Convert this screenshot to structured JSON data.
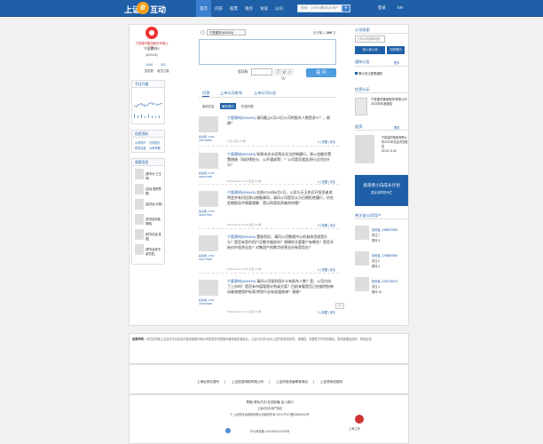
{
  "header": {
    "logo_left": "上证",
    "logo_e": "e",
    "logo_right": "互动",
    "nav": [
      "首页",
      "问答",
      "股票",
      "观点",
      "访谈",
      "公司"
    ],
    "search_placeholder": "搜索：公司/问题/观点/用户",
    "search_icon": "search-icon",
    "login": "登录",
    "lang": "EN"
  },
  "company": {
    "name_cn": "宁夏建材集团股份有限公司",
    "short": "宁夏建材V",
    "code": "(600449)",
    "followers": "1494",
    "followers_lbl": "被关注数",
    "answers": "101",
    "answers_lbl": "回答数"
  },
  "sidebar": {
    "today_title": "今日行情",
    "docs_title": "信息资料",
    "links": [
      "公司简介",
      "行情统计",
      "财务信息",
      "公司章程"
    ],
    "execs_title": "高管信息",
    "execs": [
      "[董事长 王玉林]",
      "[总经 理邢思刚]",
      "[副总经 武雄]",
      "[常务副总裁 董明]",
      "[财务总监 梁磊]",
      "[董事会秘书 谢茂发]"
    ]
  },
  "form": {
    "company_tag": "宁夏建材(600449)",
    "char_prefix": "还可输入",
    "char_count": "200",
    "char_suffix": "字",
    "captcha_label": "验证码",
    "captcha_text": "T g j W",
    "submit": "提 问"
  },
  "tabs": [
    "问答",
    "上市公司发布",
    "上市公司公告"
  ],
  "subtabs": [
    "最新答复",
    "最新提问",
    "热搜问题"
  ],
  "questions": [
    {
      "user": "投资者_1703 470794000",
      "co": "宁夏建材(600449)",
      "text": "请问截止4月20日公司的股东人数是多少？，谢谢？",
      "meta": "今日 来自 PC端",
      "like": "0",
      "fav": "收藏",
      "reply": "评论"
    },
    {
      "user": "投资者_1778 394157455",
      "co": "宁夏建材(600449)",
      "text": "知果本次水泥两次无法控制履行，贵公会额实置置措施（如纪律处分、公开谴或等）？公司是否就此进行过问拉什么？",
      "meta": "2023-04-20 11:40 来自 PC端",
      "like": "0",
      "fav": "收藏",
      "reply": "评论"
    },
    {
      "user": "投资者_1778 394157455",
      "co": "宁夏建材(600449)",
      "text": "告知2024年8月2日，公司与天玉农召开投资者说明会并有问回答以按备事项，请问公司是否认为召期拒绝履行，仿在定期报告中第要理解：是以再是投资者的何懂？",
      "meta": "2023-04-20 11:39 来自 PC端",
      "like": "0",
      "fav": "收藏",
      "reply": "评论"
    },
    {
      "user": "投资者_1719 913173000",
      "co": "宁夏建材(600449)",
      "text": "董秘您好。请问公司数据中心的具体用途是什么？是否有签约用户且数字服务吗？规模的主要客户有哪些？是否开始对外租赁业务？对集团产的数字经营业份有是否在？",
      "meta": "2023-04-20 10:16 来自 PC端",
      "like": "0",
      "fav": "收藏",
      "reply": "评论"
    },
    {
      "user": "投资者_1703 470794000",
      "co": "宁夏建材(600449)",
      "text": "请问公司现阶段什么有股东人数？是，公司方向了上市吗？是否有市值管理计划或方案？目前来看是否已在据特别单动者和使保护标案/特别行业有发展做来？谢谢！",
      "meta": "2023-04-20 11:16 来自 PC端",
      "like": "0",
      "fav": "收藏",
      "reply": "评论"
    }
  ],
  "pager": "+",
  "right": {
    "search_title": "公司检索",
    "search_placeholder": "上市公司名称/代码",
    "btn_follow": "进入该公司",
    "btn_ask": "向其提问",
    "notice_title": "通知公告",
    "notice_more": "更多",
    "notice_item": "警示关注借想通知",
    "ann_title": "信息公示",
    "ann_text": "宁夏建材集团股份有限公司2023年年度报告",
    "board_title": "投资",
    "board_more": "更多",
    "board_text": "宁夏建材集团有限公司2022年社会责任报告",
    "board_date": "05-10 11:40",
    "banner_title": "投资者小白成长计划",
    "banner_sub": "易互动学院专栏",
    "followers_title": "关注该公司用户",
    "followers": [
      {
        "name": "投资者_1388933080",
        "n": "关注 7",
        "m": "提问 6"
      },
      {
        "name": "投资者_1756856080",
        "n": "关注 0",
        "m": "提问 0"
      },
      {
        "name": "投资者_1425749470",
        "n": "关注 3",
        "m": "提问 15"
      }
    ]
  },
  "disclaimer": {
    "label": "免责声明：",
    "text": "本栏目所载上证互动平台信息中投资者提问和公司回答仅代表提问者和回答者观点，上证e互动平台对上述内容的真实性、准确性、完整性不作任何保证，投资者据此操作，风险自担。"
  },
  "friend_links": [
    "上海证券交易所",
    "上证信息网络有限公司",
    "上证所投资者教育网站",
    "上证债券信息网"
  ],
  "footer": {
    "line1": "帮助| 联系方式| 在线投稿| 加入我们",
    "line2": "上证e互动  用户协议",
    "line3": "© 上证所信息网络有限公司版权所有 2013 沪ICP备05059341号",
    "line4": "沪公网安备 31011502014076号",
    "line5": "上海工商",
    "line6": "上海工商"
  }
}
